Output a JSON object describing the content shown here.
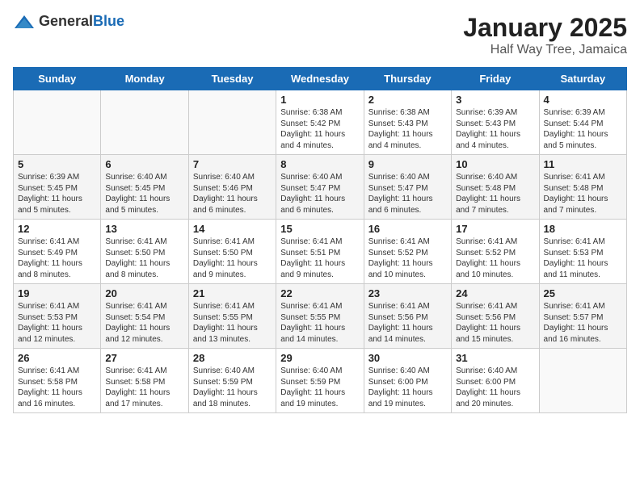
{
  "header": {
    "logo_general": "General",
    "logo_blue": "Blue",
    "month": "January 2025",
    "location": "Half Way Tree, Jamaica"
  },
  "days": [
    "Sunday",
    "Monday",
    "Tuesday",
    "Wednesday",
    "Thursday",
    "Friday",
    "Saturday"
  ],
  "weeks": [
    [
      {
        "date": "",
        "info": ""
      },
      {
        "date": "",
        "info": ""
      },
      {
        "date": "",
        "info": ""
      },
      {
        "date": "1",
        "info": "Sunrise: 6:38 AM\nSunset: 5:42 PM\nDaylight: 11 hours and 4 minutes."
      },
      {
        "date": "2",
        "info": "Sunrise: 6:38 AM\nSunset: 5:43 PM\nDaylight: 11 hours and 4 minutes."
      },
      {
        "date": "3",
        "info": "Sunrise: 6:39 AM\nSunset: 5:43 PM\nDaylight: 11 hours and 4 minutes."
      },
      {
        "date": "4",
        "info": "Sunrise: 6:39 AM\nSunset: 5:44 PM\nDaylight: 11 hours and 5 minutes."
      }
    ],
    [
      {
        "date": "5",
        "info": "Sunrise: 6:39 AM\nSunset: 5:45 PM\nDaylight: 11 hours and 5 minutes."
      },
      {
        "date": "6",
        "info": "Sunrise: 6:40 AM\nSunset: 5:45 PM\nDaylight: 11 hours and 5 minutes."
      },
      {
        "date": "7",
        "info": "Sunrise: 6:40 AM\nSunset: 5:46 PM\nDaylight: 11 hours and 6 minutes."
      },
      {
        "date": "8",
        "info": "Sunrise: 6:40 AM\nSunset: 5:47 PM\nDaylight: 11 hours and 6 minutes."
      },
      {
        "date": "9",
        "info": "Sunrise: 6:40 AM\nSunset: 5:47 PM\nDaylight: 11 hours and 6 minutes."
      },
      {
        "date": "10",
        "info": "Sunrise: 6:40 AM\nSunset: 5:48 PM\nDaylight: 11 hours and 7 minutes."
      },
      {
        "date": "11",
        "info": "Sunrise: 6:41 AM\nSunset: 5:48 PM\nDaylight: 11 hours and 7 minutes."
      }
    ],
    [
      {
        "date": "12",
        "info": "Sunrise: 6:41 AM\nSunset: 5:49 PM\nDaylight: 11 hours and 8 minutes."
      },
      {
        "date": "13",
        "info": "Sunrise: 6:41 AM\nSunset: 5:50 PM\nDaylight: 11 hours and 8 minutes."
      },
      {
        "date": "14",
        "info": "Sunrise: 6:41 AM\nSunset: 5:50 PM\nDaylight: 11 hours and 9 minutes."
      },
      {
        "date": "15",
        "info": "Sunrise: 6:41 AM\nSunset: 5:51 PM\nDaylight: 11 hours and 9 minutes."
      },
      {
        "date": "16",
        "info": "Sunrise: 6:41 AM\nSunset: 5:52 PM\nDaylight: 11 hours and 10 minutes."
      },
      {
        "date": "17",
        "info": "Sunrise: 6:41 AM\nSunset: 5:52 PM\nDaylight: 11 hours and 10 minutes."
      },
      {
        "date": "18",
        "info": "Sunrise: 6:41 AM\nSunset: 5:53 PM\nDaylight: 11 hours and 11 minutes."
      }
    ],
    [
      {
        "date": "19",
        "info": "Sunrise: 6:41 AM\nSunset: 5:53 PM\nDaylight: 11 hours and 12 minutes."
      },
      {
        "date": "20",
        "info": "Sunrise: 6:41 AM\nSunset: 5:54 PM\nDaylight: 11 hours and 12 minutes."
      },
      {
        "date": "21",
        "info": "Sunrise: 6:41 AM\nSunset: 5:55 PM\nDaylight: 11 hours and 13 minutes."
      },
      {
        "date": "22",
        "info": "Sunrise: 6:41 AM\nSunset: 5:55 PM\nDaylight: 11 hours and 14 minutes."
      },
      {
        "date": "23",
        "info": "Sunrise: 6:41 AM\nSunset: 5:56 PM\nDaylight: 11 hours and 14 minutes."
      },
      {
        "date": "24",
        "info": "Sunrise: 6:41 AM\nSunset: 5:56 PM\nDaylight: 11 hours and 15 minutes."
      },
      {
        "date": "25",
        "info": "Sunrise: 6:41 AM\nSunset: 5:57 PM\nDaylight: 11 hours and 16 minutes."
      }
    ],
    [
      {
        "date": "26",
        "info": "Sunrise: 6:41 AM\nSunset: 5:58 PM\nDaylight: 11 hours and 16 minutes."
      },
      {
        "date": "27",
        "info": "Sunrise: 6:41 AM\nSunset: 5:58 PM\nDaylight: 11 hours and 17 minutes."
      },
      {
        "date": "28",
        "info": "Sunrise: 6:40 AM\nSunset: 5:59 PM\nDaylight: 11 hours and 18 minutes."
      },
      {
        "date": "29",
        "info": "Sunrise: 6:40 AM\nSunset: 5:59 PM\nDaylight: 11 hours and 19 minutes."
      },
      {
        "date": "30",
        "info": "Sunrise: 6:40 AM\nSunset: 6:00 PM\nDaylight: 11 hours and 19 minutes."
      },
      {
        "date": "31",
        "info": "Sunrise: 6:40 AM\nSunset: 6:00 PM\nDaylight: 11 hours and 20 minutes."
      },
      {
        "date": "",
        "info": ""
      }
    ]
  ]
}
